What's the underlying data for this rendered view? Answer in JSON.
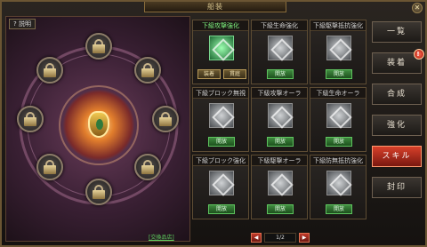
{
  "window": {
    "title": "船装"
  },
  "left": {
    "help_label": "説明",
    "exchange_link": "[交換品店]"
  },
  "grid": [
    {
      "title": "下級攻撃強化",
      "active": true,
      "buttons": [
        "装着",
        "貫庭"
      ]
    },
    {
      "title": "下級生命強化",
      "active": false,
      "buttons": [
        "開放"
      ]
    },
    {
      "title": "下級駆撃抵抗強化",
      "active": false,
      "buttons": [
        "開放"
      ]
    },
    {
      "title": "下級ブロック無視",
      "active": false,
      "buttons": [
        "開放"
      ]
    },
    {
      "title": "下級攻撃オーラ",
      "active": false,
      "buttons": [
        "開放"
      ]
    },
    {
      "title": "下級生命オーラ",
      "active": false,
      "buttons": [
        "開放"
      ]
    },
    {
      "title": "下級ブロック強化",
      "active": false,
      "buttons": [
        "開放"
      ]
    },
    {
      "title": "下級駆撃オーラ",
      "active": false,
      "buttons": [
        "開放"
      ]
    },
    {
      "title": "下級防無抵抗強化",
      "active": false,
      "buttons": [
        "開放"
      ]
    }
  ],
  "pager": {
    "prev": "◀",
    "page": "1/2",
    "next": "▶"
  },
  "menu": [
    {
      "label": "一覧",
      "active": false,
      "badge": ""
    },
    {
      "label": "装着",
      "active": false,
      "badge": "!"
    },
    {
      "label": "合成",
      "active": false,
      "badge": ""
    },
    {
      "label": "強化",
      "active": false,
      "badge": ""
    },
    {
      "label": "スキル",
      "active": true,
      "badge": ""
    },
    {
      "label": "封印",
      "active": false,
      "badge": ""
    }
  ],
  "colors": {
    "accent_red": "#d8402a",
    "active_green": "#7df07d",
    "frame_gold": "#6b5533"
  }
}
